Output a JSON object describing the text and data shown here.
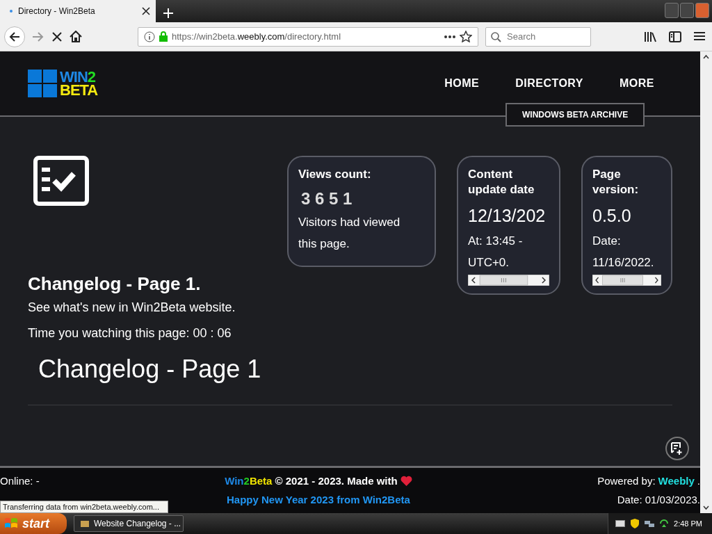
{
  "browser": {
    "tab": {
      "title": "Directory - Win2Beta",
      "loading": true
    },
    "url": {
      "prefix": "https://win2beta.",
      "domain": "weebly.com",
      "path": "/directory.html"
    },
    "search": {
      "placeholder": "Search"
    },
    "forward_disabled": true
  },
  "header": {
    "logo": {
      "word": "WIN",
      "digit": "2",
      "word2": "BETA"
    },
    "nav": [
      {
        "label": "HOME"
      },
      {
        "label": "DIRECTORY"
      },
      {
        "label": "MORE"
      }
    ],
    "submenu": [
      "WINDOWS BETA ARCHIVE"
    ]
  },
  "intro": {
    "title": "Changelog - Page 1.",
    "subtitle": "See what's new in Win2Beta website.",
    "timer": "Time you watching this page: 00 : 06",
    "heading": "Changelog - Page 1"
  },
  "cards": [
    {
      "kind": "counter",
      "title": "Views count:",
      "value": "3 6 5 1",
      "lines": [
        "Visitors had viewed",
        "this page."
      ]
    },
    {
      "kind": "scroll",
      "title": "Content update date",
      "value": "12/13/202",
      "lines": [
        "At: 13:45 -",
        "UTC+0."
      ]
    },
    {
      "kind": "scroll",
      "title": "Page version:",
      "value": "0.5.0",
      "lines": [
        "Date:",
        "11/16/2022."
      ]
    }
  ],
  "footer": {
    "online": "Online: -",
    "credit": {
      "brand": [
        {
          "text": "Win",
          "color": "#1e88e5"
        },
        {
          "text": "2",
          "color": "#22cc22"
        },
        {
          "text": "Beta",
          "color": "#f2e600"
        }
      ],
      "text": "© 2021 - 2023. Made with"
    },
    "greeting": "Happy New Year 2023 from Win2Beta",
    "powered_label": "Powered by:",
    "powered_link": "Weebly",
    "powered_suffix": ".",
    "date": "Date: 01/03/2023."
  },
  "status_text": "Transferring data from win2beta.weebly.com...",
  "taskbar": {
    "start": "start",
    "task": "Website Changelog - ...",
    "clock": "2:48 PM"
  }
}
